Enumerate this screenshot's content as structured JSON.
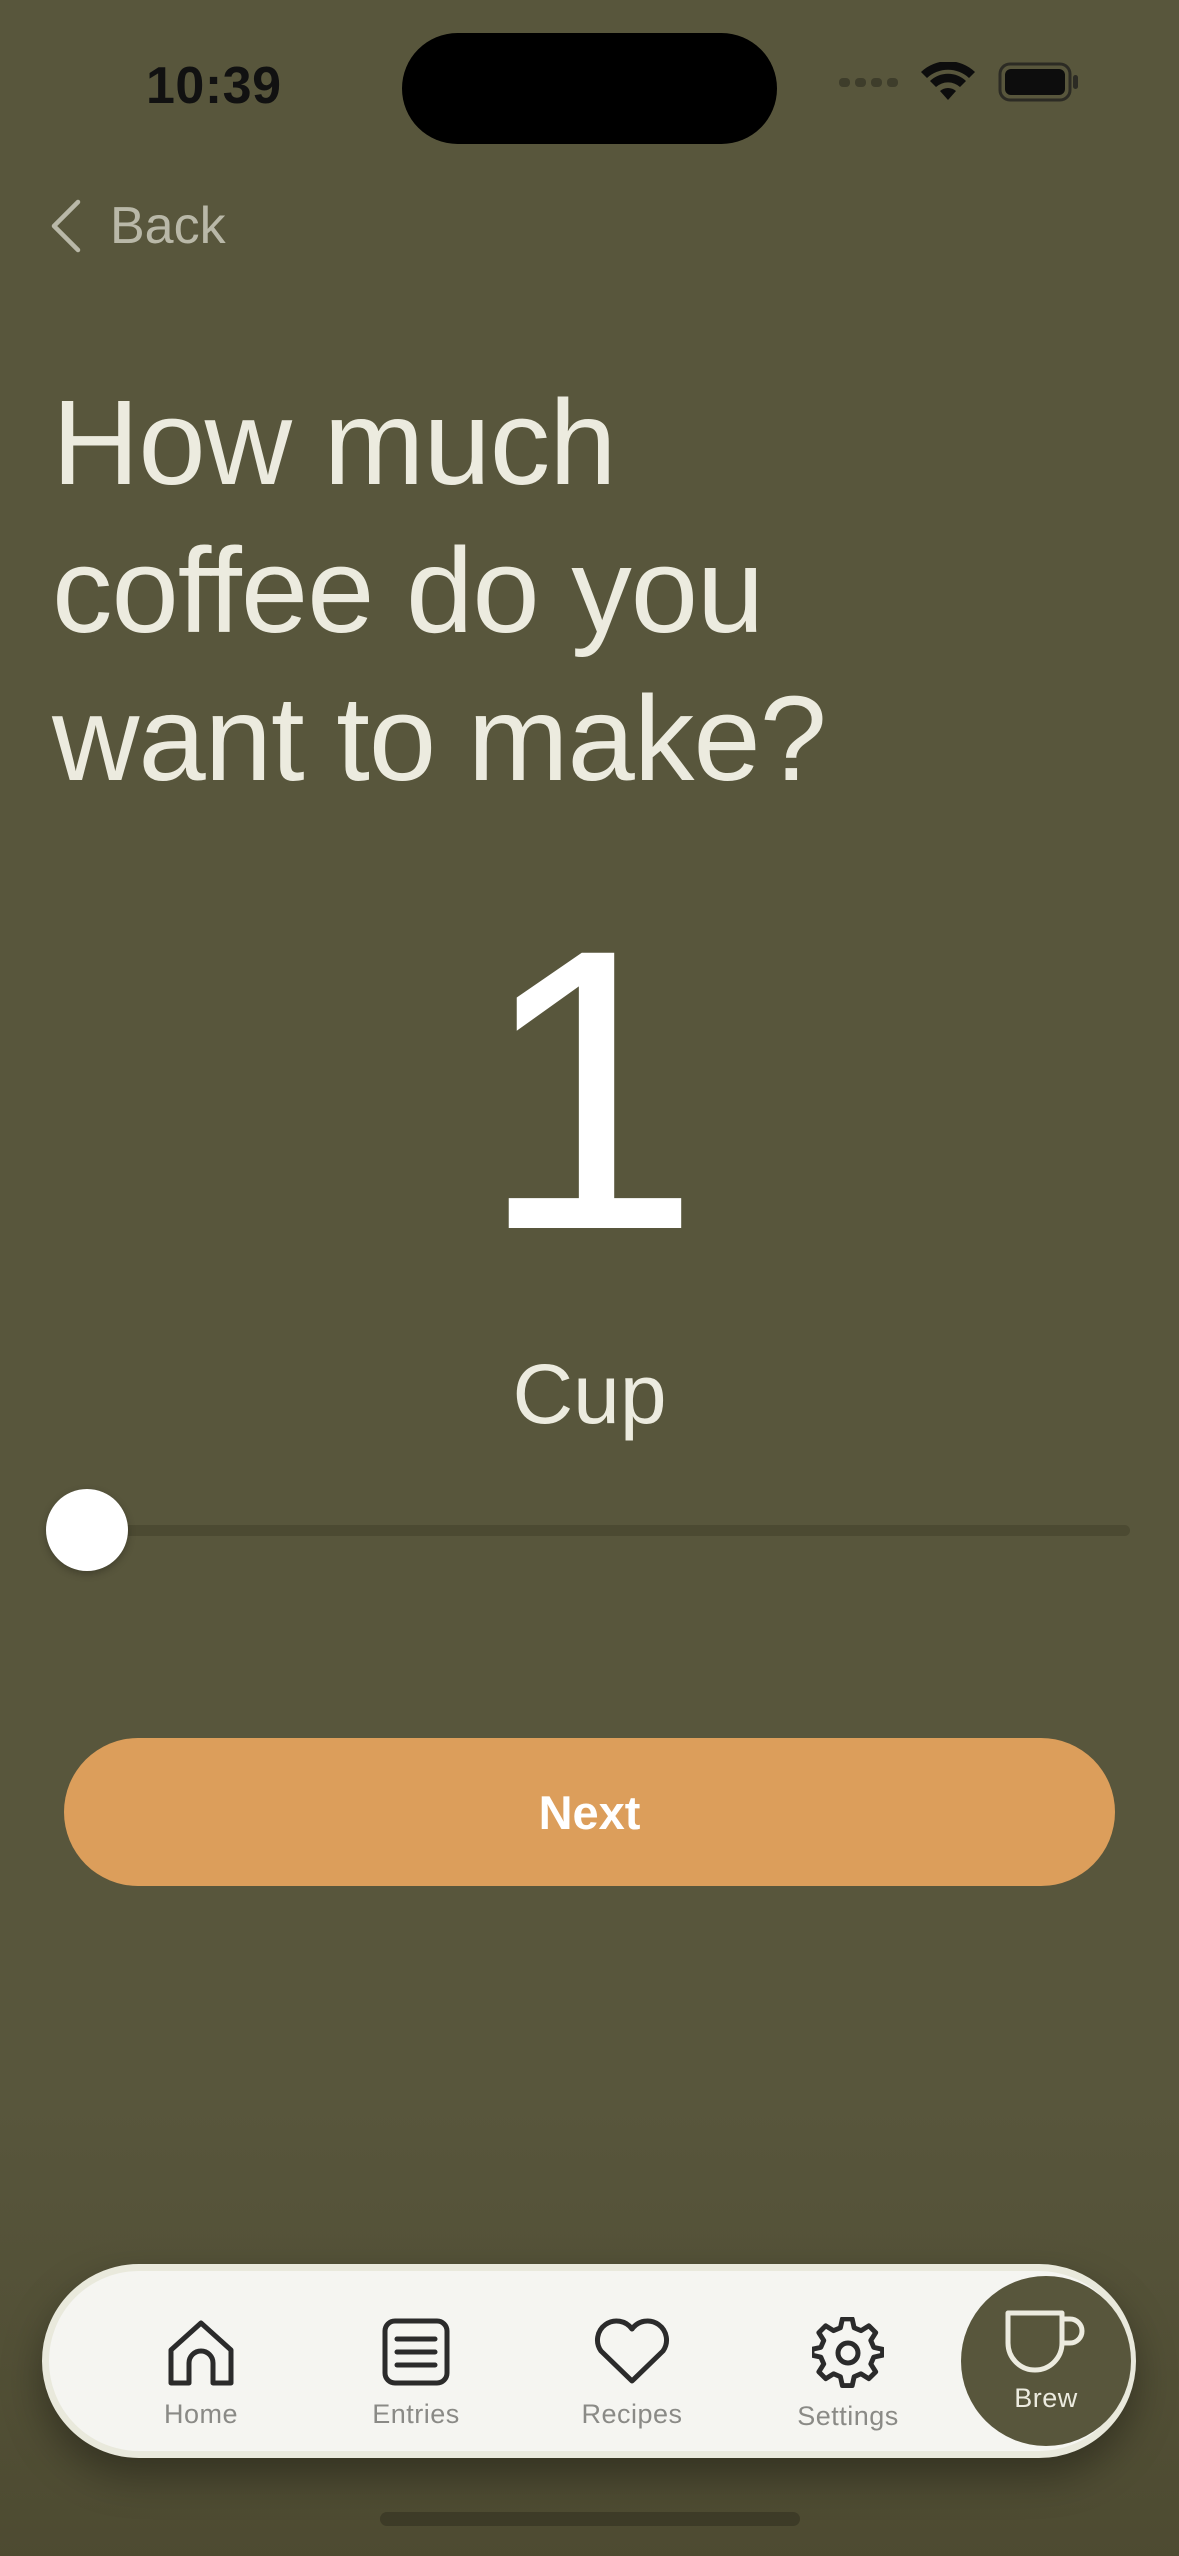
{
  "status_bar": {
    "time": "10:39",
    "icons": [
      "cellular-signal-icon",
      "wifi-icon",
      "battery-icon"
    ]
  },
  "nav": {
    "back_label": "Back",
    "back_icon": "chevron-left-icon"
  },
  "question": {
    "line1": "How much",
    "line2": "coffee do you",
    "line3": "want to make?"
  },
  "quantity": {
    "value": "1",
    "unit": "Cup",
    "slider_fraction": 0
  },
  "next_button": {
    "label": "Next"
  },
  "tab_bar": {
    "items": [
      {
        "label": "Home",
        "icon": "home-icon"
      },
      {
        "label": "Entries",
        "icon": "list-icon"
      },
      {
        "label": "Recipes",
        "icon": "heart-icon"
      },
      {
        "label": "Settings",
        "icon": "gear-icon"
      },
      {
        "label": "Brew",
        "icon": "cup-icon",
        "active": true
      }
    ]
  },
  "colors": {
    "background": "#58563c",
    "text": "#ecebdf",
    "accent": "#dc9e5b",
    "tabbar": "#f5f5f1"
  }
}
